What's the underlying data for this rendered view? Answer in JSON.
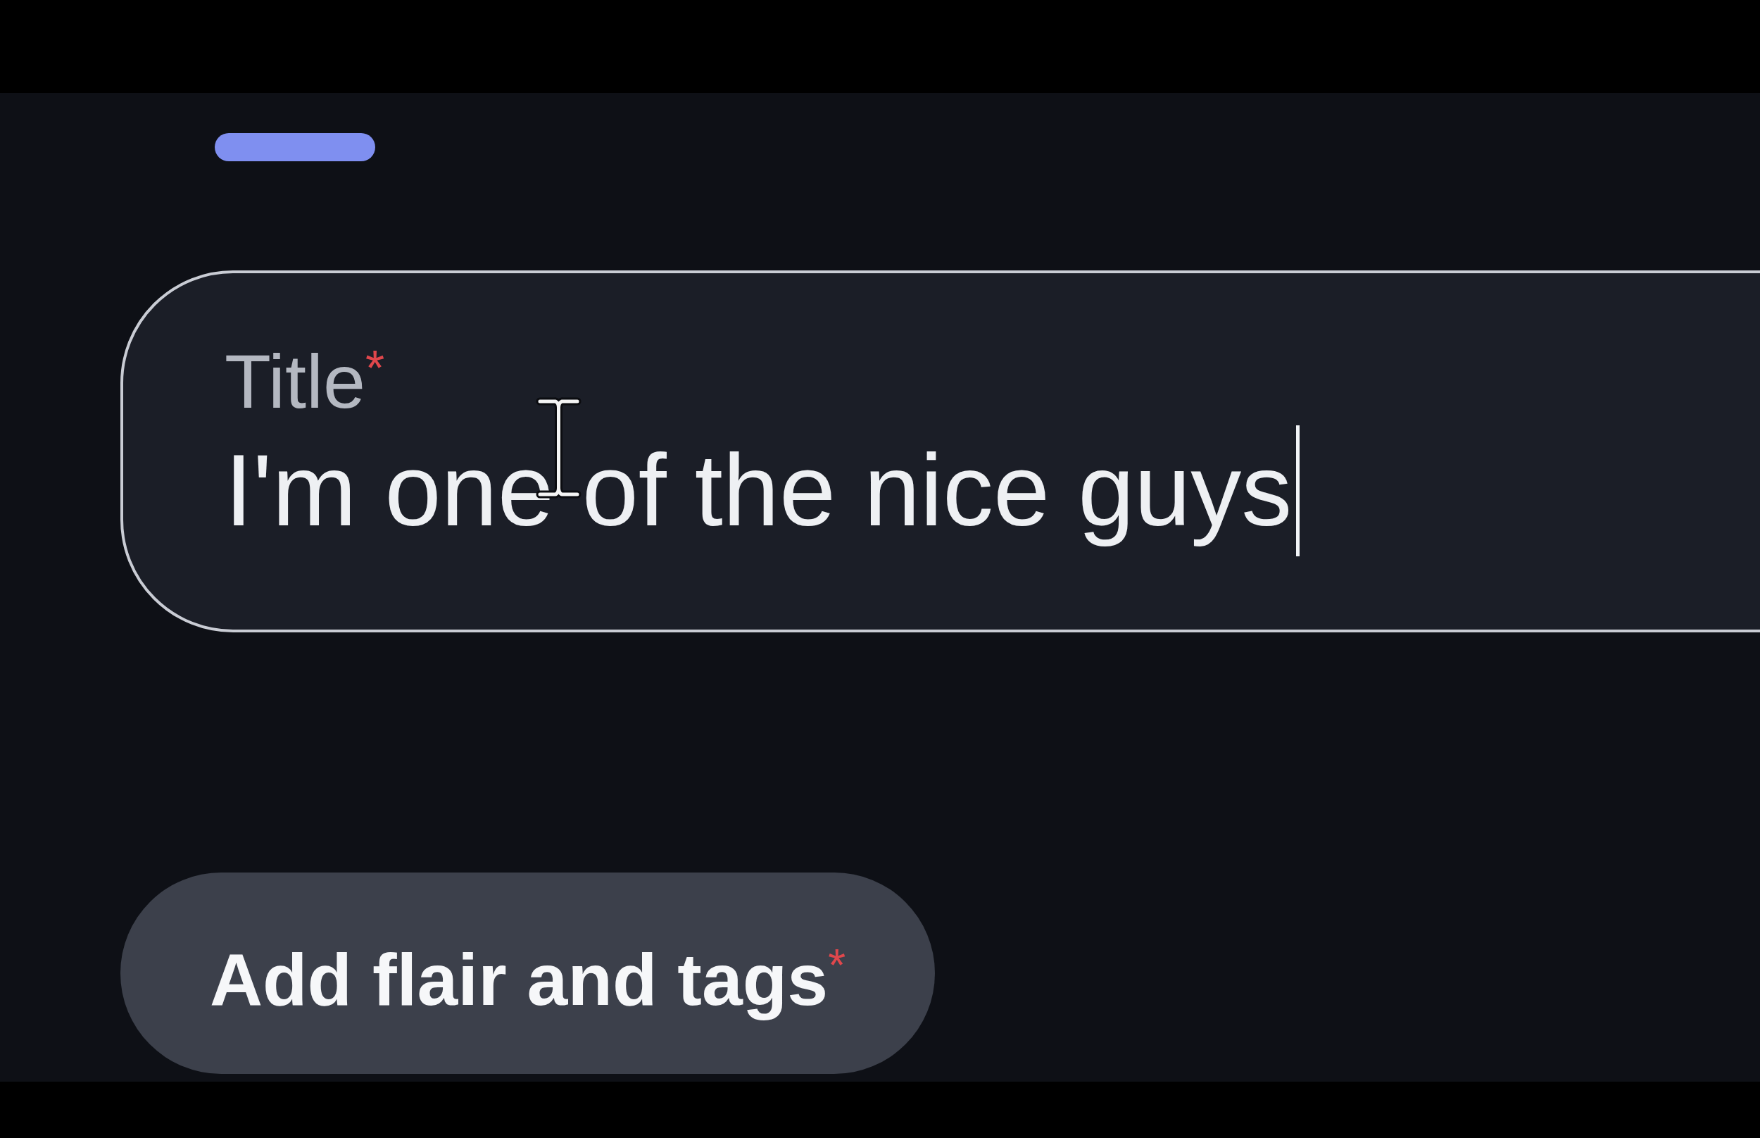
{
  "tab": {
    "selected": true
  },
  "title_field": {
    "label": "Title",
    "required_mark": "*",
    "value": "I'm one of the nice guys",
    "focused": true
  },
  "flair_button": {
    "label": "Add flair and tags",
    "required_mark": "*"
  }
}
